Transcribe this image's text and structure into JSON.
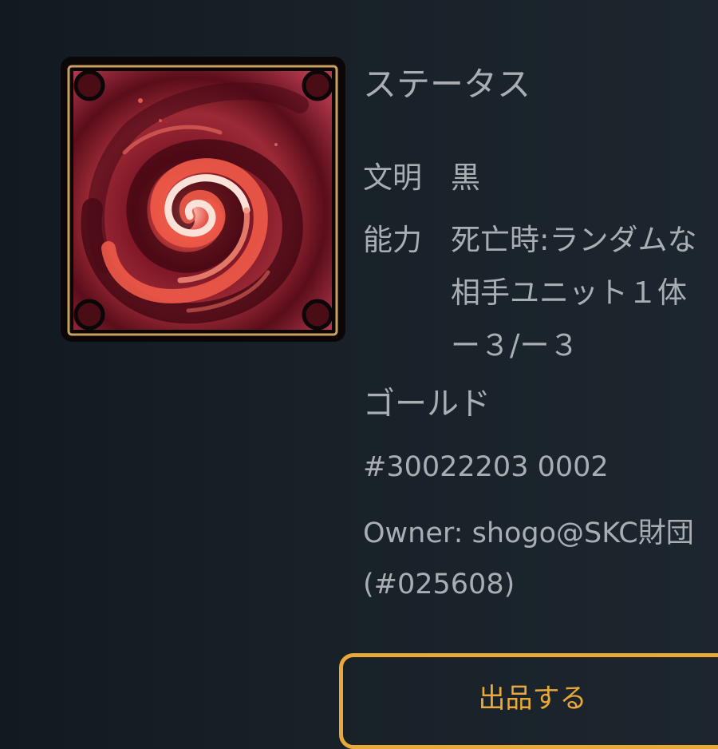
{
  "card": {
    "image_icon": "crimson-vortex-art"
  },
  "status": {
    "title": "ステータス",
    "civilization_label": "文明",
    "civilization_value": "黒",
    "ability_label": "能力",
    "ability_lines": [
      "死亡時:ランダムな",
      "相手ユニット１体",
      "ー３/ー３"
    ],
    "rarity": "ゴールド",
    "serial": "#30022203 0002",
    "owner_line1": "Owner: shogo@SKC財団",
    "owner_line2": "(#025608)"
  },
  "actions": {
    "sell_label": "出品する"
  },
  "colors": {
    "background": "#182128",
    "text": "#a9aeb3",
    "accent": "#e9a93a",
    "frame_gold": "#c9a25f"
  }
}
